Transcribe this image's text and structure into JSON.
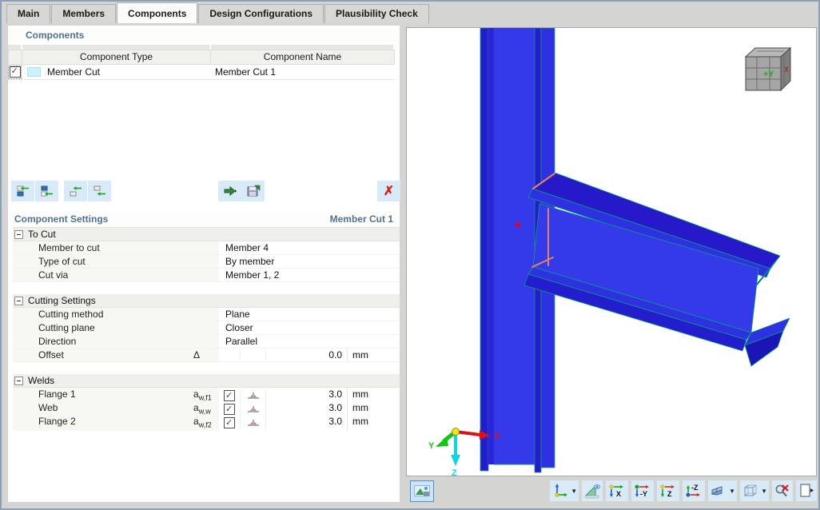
{
  "tabs": [
    {
      "label": "Main"
    },
    {
      "label": "Members"
    },
    {
      "label": "Components"
    },
    {
      "label": "Design Configurations"
    },
    {
      "label": "Plausibility Check"
    }
  ],
  "active_tab": "Components",
  "components_panel": {
    "title": "Components",
    "columns": {
      "type": "Component Type",
      "name": "Component Name"
    },
    "row": {
      "checked": true,
      "swatch_color": "#c9f2fa",
      "type": "Member Cut",
      "name": "Member Cut 1"
    }
  },
  "settings_panel": {
    "title": "Component Settings",
    "context": "Member Cut 1",
    "groups": [
      {
        "label": "To Cut",
        "rows": [
          {
            "label": "Member to cut",
            "value": "Member 4"
          },
          {
            "label": "Type of cut",
            "value": "By member"
          },
          {
            "label": "Cut via",
            "value": "Member 1, 2"
          }
        ]
      },
      {
        "label": "Cutting Settings",
        "rows": [
          {
            "label": "Cutting method",
            "value": "Plane"
          },
          {
            "label": "Cutting plane",
            "value": "Closer"
          },
          {
            "label": "Direction",
            "value": "Parallel"
          },
          {
            "label": "Offset",
            "symbol": "Δ",
            "value": "0.0",
            "unit": "mm"
          }
        ]
      },
      {
        "label": "Welds",
        "rows": [
          {
            "label": "Flange 1",
            "symbol_base": "a",
            "symbol_sub": "w,f1",
            "checked": true,
            "value": "3.0",
            "unit": "mm"
          },
          {
            "label": "Web",
            "symbol_base": "a",
            "symbol_sub": "w,w",
            "checked": true,
            "value": "3.0",
            "unit": "mm"
          },
          {
            "label": "Flange 2",
            "symbol_base": "a",
            "symbol_sub": "w,f2",
            "checked": true,
            "value": "3.0",
            "unit": "mm"
          }
        ]
      }
    ]
  },
  "viewport": {
    "axes": {
      "x": "X",
      "y": "Y",
      "z": "Z"
    },
    "nav_cube": {
      "front": "+Y",
      "side": "X"
    },
    "colors": {
      "member_blue": "#3439ea",
      "member_dark_blue": "#231dcd",
      "edge_teal": "#0a9b82",
      "weld_orange": "#e4845c",
      "node_red": "#e80020"
    }
  },
  "view_toolbar": {
    "x_label": "X",
    "neg_y_label": "-Y",
    "z_label": "Z",
    "neg_z_label": "-Z"
  }
}
